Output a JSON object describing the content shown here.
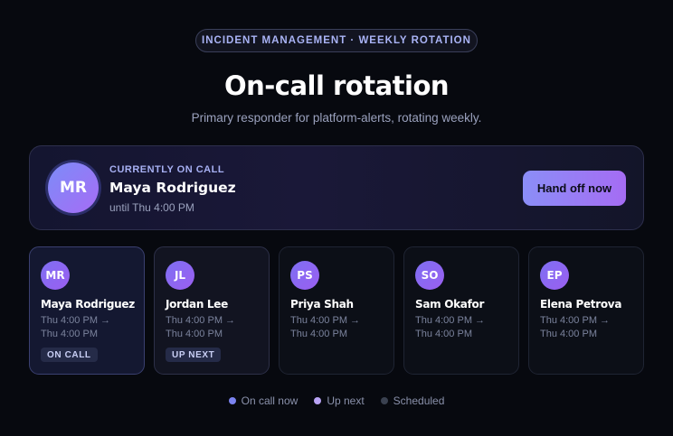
{
  "header": {
    "eyebrow": "INCIDENT MANAGEMENT · WEEKLY ROTATION",
    "title": "On-call rotation",
    "subtitle": "Primary responder for platform-alerts, rotating weekly."
  },
  "current": {
    "initials": "MR",
    "label": "CURRENTLY ON CALL",
    "name": "Maya Rodriguez",
    "until": "until Thu 4:00 PM",
    "handoff_label": "Hand off now"
  },
  "rotation": [
    {
      "initials": "MR",
      "name": "Maya Rodriguez",
      "line1": "Thu 4:00 PM →",
      "line2": "Thu 4:00 PM",
      "status": "ON CALL"
    },
    {
      "initials": "JL",
      "name": "Jordan Lee",
      "line1": "Thu 4:00 PM →",
      "line2": "Thu 4:00 PM",
      "status": "UP NEXT"
    },
    {
      "initials": "PS",
      "name": "Priya Shah",
      "line1": "Thu 4:00 PM →",
      "line2": "Thu 4:00 PM",
      "status": ""
    },
    {
      "initials": "SO",
      "name": "Sam Okafor",
      "line1": "Thu 4:00 PM →",
      "line2": "Thu 4:00 PM",
      "status": ""
    },
    {
      "initials": "EP",
      "name": "Elena Petrova",
      "line1": "Thu 4:00 PM →",
      "line2": "Thu 4:00 PM",
      "status": ""
    }
  ],
  "legend": [
    {
      "label": "On call now",
      "color": "#7b83f0"
    },
    {
      "label": "Up next",
      "color": "#b9a3f5"
    },
    {
      "label": "Scheduled",
      "color": "#3a4150"
    }
  ]
}
